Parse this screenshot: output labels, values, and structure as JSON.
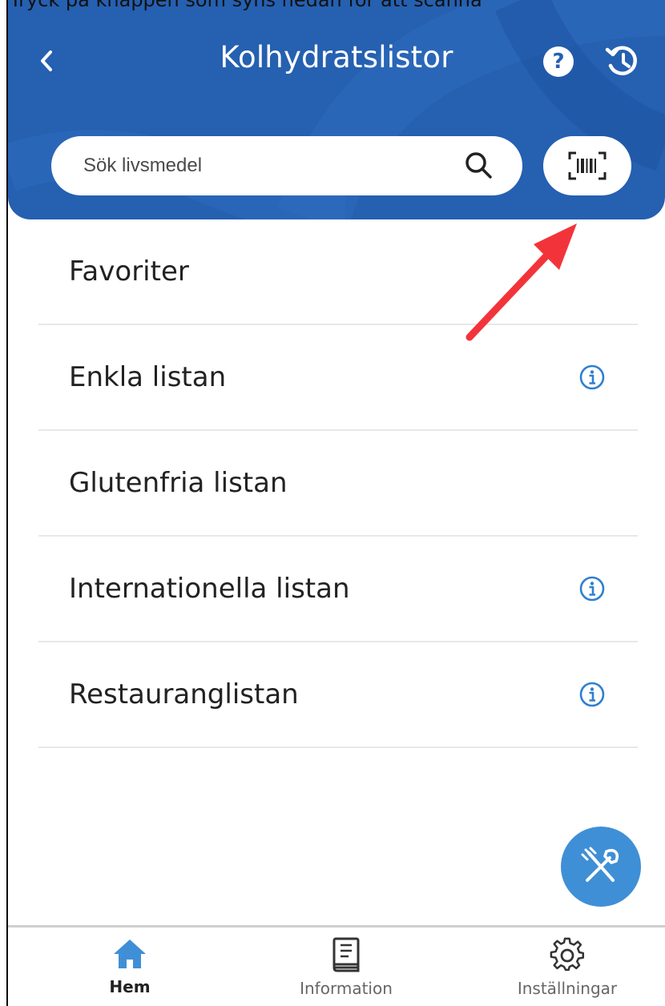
{
  "caption_fragment": "Tryck på knappen som syns nedan för att scanna",
  "header": {
    "title": "Kolhydratslistor",
    "help_symbol": "?"
  },
  "search": {
    "placeholder": "Sök livsmedel"
  },
  "lists": [
    {
      "label": "Favoriter",
      "has_info": false
    },
    {
      "label": "Enkla listan",
      "has_info": true
    },
    {
      "label": "Glutenfria listan",
      "has_info": false
    },
    {
      "label": "Internationella listan",
      "has_info": true
    },
    {
      "label": "Restauranglistan",
      "has_info": true
    }
  ],
  "bottom_nav": [
    {
      "label": "Hem",
      "icon": "home-icon",
      "active": true
    },
    {
      "label": "Information",
      "icon": "book-icon",
      "active": false
    },
    {
      "label": "Inställningar",
      "icon": "gear-icon",
      "active": false
    }
  ],
  "colors": {
    "header_bg": "#2560b1",
    "accent_blue": "#2f7fd0",
    "fab_bg": "#3f8fd6",
    "annotation_arrow": "#f2343a"
  }
}
